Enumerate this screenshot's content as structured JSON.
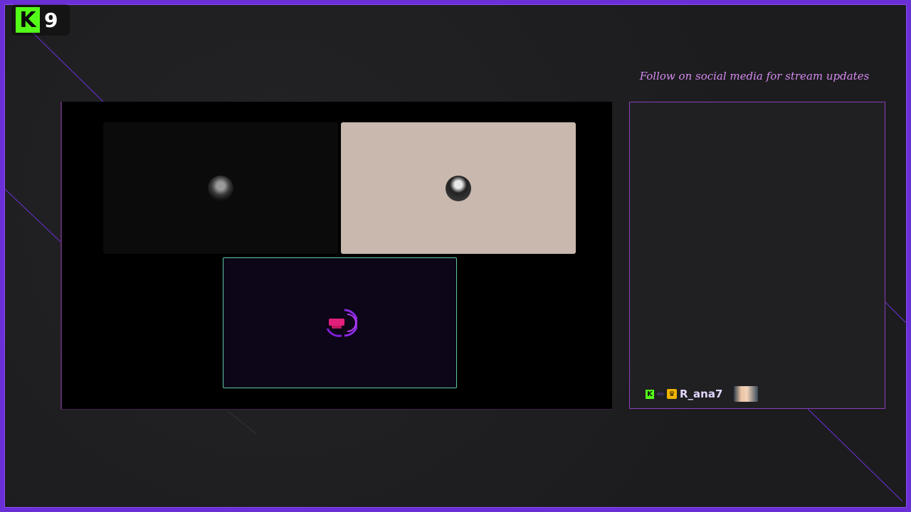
{
  "platform": {
    "name": "K",
    "viewer_count": "9",
    "brand_color": "#53fc18",
    "icon": "kick-logo-icon"
  },
  "frame": {
    "accent": "#6b2fd6"
  },
  "call": {
    "tiles": [
      {
        "id": "participant-1",
        "avatar": "person-avatar-grayscale",
        "background": "#0b0b0b"
      },
      {
        "id": "participant-2",
        "avatar": "person-avatar-dark-hood",
        "background": "#c8b8ad"
      },
      {
        "id": "participant-3",
        "avatar": "channel-logo-mark",
        "background": "#0d0518",
        "highlight": "#5fc9a8"
      }
    ]
  },
  "chat": {
    "title": "Follow on social media for stream updates",
    "messages": [
      {
        "username": "R_ana7",
        "badges": [
          "kick-badge-icon",
          "subscriber-badge-icon",
          "crown-badge-icon"
        ],
        "emote": "face-emote"
      }
    ],
    "border_color": "#8a3fb8",
    "title_color": "#d58bf0"
  }
}
